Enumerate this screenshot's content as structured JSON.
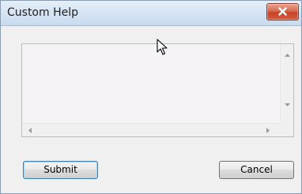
{
  "window": {
    "title": "Custom Help"
  },
  "titlebar": {
    "close_icon": "close-x-icon"
  },
  "help_text": {
    "value": ""
  },
  "buttons": {
    "submit_label": "Submit",
    "cancel_label": "Cancel"
  },
  "icons": {
    "scroll_up": "scroll-up-arrow-icon",
    "scroll_down": "scroll-down-arrow-icon",
    "scroll_left": "scroll-left-arrow-icon",
    "scroll_right": "scroll-right-arrow-icon",
    "cursor": "mouse-pointer-icon"
  },
  "colors": {
    "titlebar": "#d7e5f5",
    "close_button": "#c7432a",
    "window_bg": "#f0f0f0",
    "default_button_border": "#3c7fb1"
  }
}
